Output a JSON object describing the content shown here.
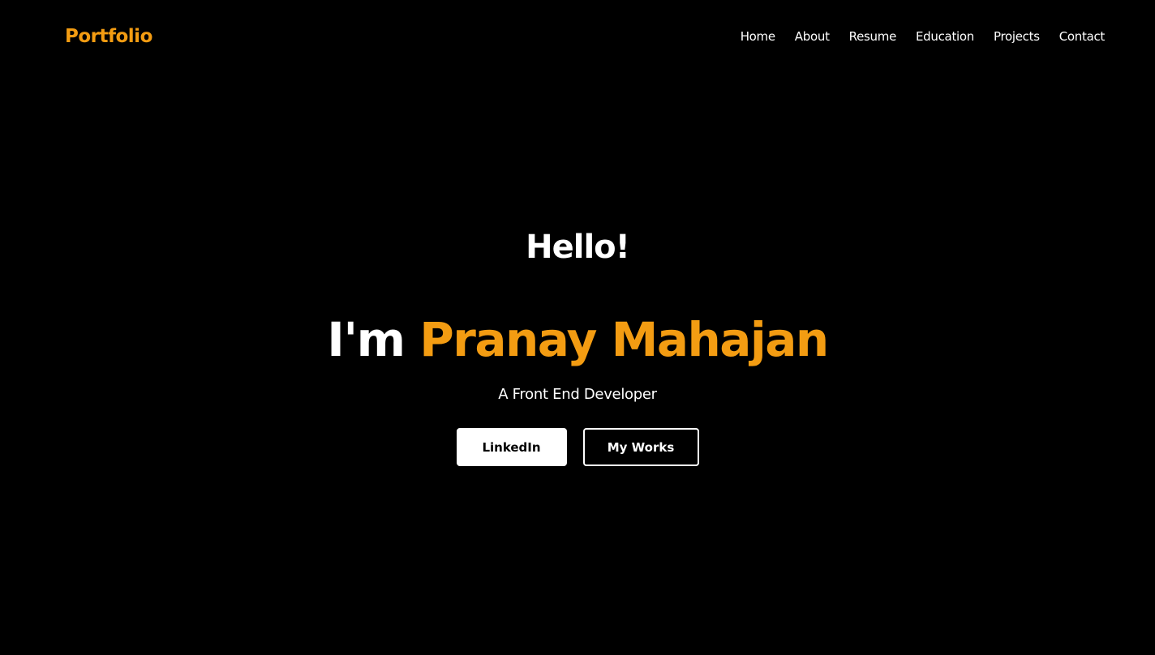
{
  "navbar": {
    "brand": "Portfolio",
    "links": [
      {
        "label": "Home"
      },
      {
        "label": "About"
      },
      {
        "label": "Resume"
      },
      {
        "label": "Education"
      },
      {
        "label": "Projects"
      },
      {
        "label": "Contact"
      }
    ]
  },
  "hero": {
    "greeting": "Hello!",
    "name_prefix": "I'm",
    "name": "Pranay Mahajan",
    "tagline": "A Front End Developer",
    "buttons": {
      "primary_label": "LinkedIn",
      "secondary_label": "My Works"
    }
  },
  "colors": {
    "accent": "#f39c12",
    "background": "#000000",
    "text": "#ffffff"
  }
}
